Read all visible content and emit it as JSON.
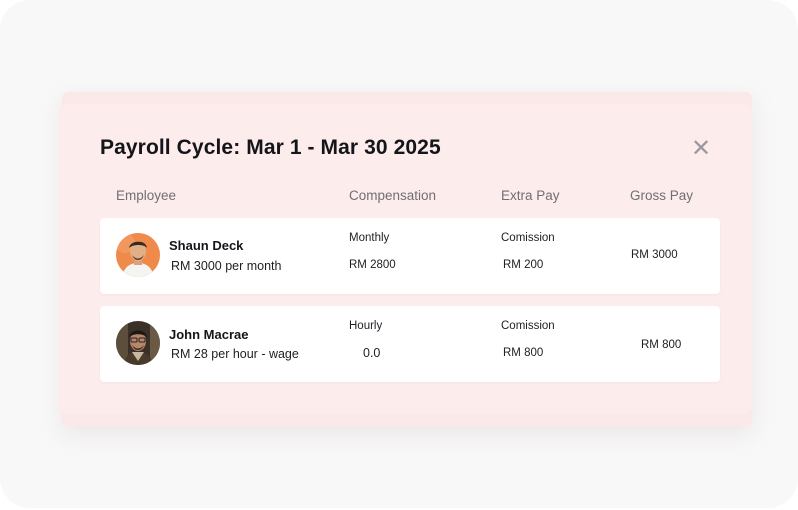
{
  "title": "Payroll Cycle: Mar 1 - Mar 30 2025",
  "close_glyph": "✕",
  "columns": {
    "employee": "Employee",
    "compensation": "Compensation",
    "extra_pay": "Extra Pay",
    "gross_pay": "Gross Pay"
  },
  "rows": [
    {
      "name": "Shaun Deck",
      "rate": "RM 3000 per month",
      "comp_type": "Monthly",
      "comp_value": "RM 2800",
      "extra_type": "Comission",
      "extra_value": "RM 200",
      "gross": "RM 3000",
      "avatar_bg": "#f08a4b"
    },
    {
      "name": "John Macrae",
      "rate": "RM 28 per hour - wage",
      "comp_type": "Hourly",
      "comp_value": "0.0",
      "extra_type": "Comission",
      "extra_value": "RM 800",
      "gross": "RM 800",
      "avatar_bg": "#3a3028"
    }
  ]
}
